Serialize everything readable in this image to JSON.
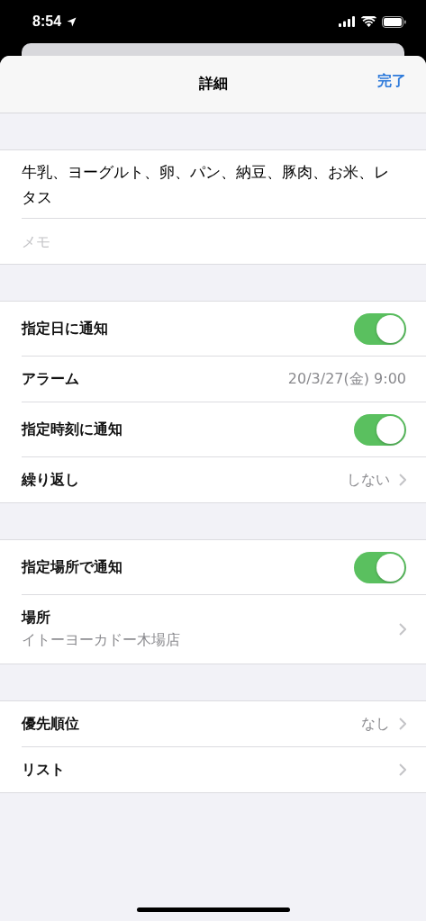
{
  "status_bar": {
    "time": "8:54"
  },
  "header": {
    "title": "詳細",
    "done": "完了"
  },
  "note": {
    "title": "牛乳、ヨーグルト、卵、パン、納豆、豚肉、お米、レタス",
    "notes_placeholder": "メモ"
  },
  "sections": [
    {
      "rows": [
        {
          "kind": "toggle",
          "label": "指定日に通知",
          "on": true
        },
        {
          "kind": "value",
          "label": "アラーム",
          "value": "20/3/27(金) 9:00",
          "chevron": false
        },
        {
          "kind": "toggle",
          "label": "指定時刻に通知",
          "on": true
        },
        {
          "kind": "value",
          "label": "繰り返し",
          "value": "しない",
          "chevron": true
        }
      ]
    },
    {
      "rows": [
        {
          "kind": "toggle",
          "label": "指定場所で通知",
          "on": true
        },
        {
          "kind": "subtitle",
          "label": "場所",
          "value": "イトーヨーカドー木場店",
          "chevron": true
        }
      ]
    },
    {
      "rows": [
        {
          "kind": "value",
          "label": "優先順位",
          "value": "なし",
          "chevron": true
        },
        {
          "kind": "value",
          "label": "リスト",
          "chevron": true
        }
      ]
    }
  ]
}
